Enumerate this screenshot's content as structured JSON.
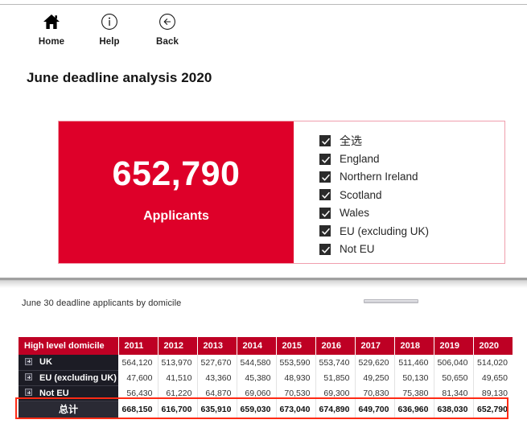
{
  "nav": {
    "items": [
      {
        "label": "Home",
        "icon": "home-icon"
      },
      {
        "label": "Help",
        "icon": "info-circle-icon"
      },
      {
        "label": "Back",
        "icon": "back-arrow-circle-icon"
      }
    ]
  },
  "page": {
    "title": "June deadline analysis 2020"
  },
  "hero": {
    "number": "652,790",
    "caption": "Applicants",
    "color": "#DE0029"
  },
  "filters": {
    "items": [
      {
        "label": "全选",
        "checked": true,
        "cjk": true
      },
      {
        "label": "England",
        "checked": true,
        "cjk": false
      },
      {
        "label": "Northern Ireland",
        "checked": true,
        "cjk": false
      },
      {
        "label": "Scotland",
        "checked": true,
        "cjk": false
      },
      {
        "label": "Wales",
        "checked": true,
        "cjk": false
      },
      {
        "label": "EU (excluding UK)",
        "checked": true,
        "cjk": false
      },
      {
        "label": "Not EU",
        "checked": true,
        "cjk": false
      }
    ]
  },
  "chart_section": {
    "caption": "June 30 deadline applicants by domicile"
  },
  "chart_data": {
    "type": "table",
    "title": "June 30 deadline applicants by domicile",
    "xlabel": "",
    "ylabel": "",
    "header_label": "High level domicile",
    "categories": [
      "2011",
      "2012",
      "2013",
      "2014",
      "2015",
      "2016",
      "2017",
      "2018",
      "2019",
      "2020"
    ],
    "series": [
      {
        "name": "UK",
        "values": [
          564120,
          513970,
          527670,
          544580,
          553590,
          553740,
          529620,
          511460,
          506040,
          514020
        ]
      },
      {
        "name": "EU (excluding UK)",
        "values": [
          47600,
          41510,
          43360,
          45380,
          48930,
          51850,
          49250,
          50130,
          50650,
          49650
        ]
      },
      {
        "name": "Not EU",
        "values": [
          56430,
          61220,
          64870,
          69060,
          70530,
          69300,
          70830,
          75380,
          81340,
          89130
        ]
      },
      {
        "name": "总计",
        "values": [
          668150,
          616700,
          635910,
          659030,
          673040,
          674890,
          649700,
          636960,
          638030,
          652790
        ]
      }
    ],
    "rows": [
      {
        "label": "UK",
        "expandable": true,
        "total": false,
        "values": [
          "564,120",
          "513,970",
          "527,670",
          "544,580",
          "553,590",
          "553,740",
          "529,620",
          "511,460",
          "506,040",
          "514,020"
        ]
      },
      {
        "label": "EU (excluding UK)",
        "expandable": true,
        "total": false,
        "values": [
          "47,600",
          "41,510",
          "43,360",
          "45,380",
          "48,930",
          "51,850",
          "49,250",
          "50,130",
          "50,650",
          "49,650"
        ]
      },
      {
        "label": "Not EU",
        "expandable": true,
        "total": false,
        "values": [
          "56,430",
          "61,220",
          "64,870",
          "69,060",
          "70,530",
          "69,300",
          "70,830",
          "75,380",
          "81,340",
          "89,130"
        ]
      },
      {
        "label": "总计",
        "expandable": false,
        "total": true,
        "values": [
          "668,150",
          "616,700",
          "635,910",
          "659,030",
          "673,040",
          "674,890",
          "649,700",
          "636,960",
          "638,030",
          "652,790"
        ]
      }
    ],
    "highlight_row_color": "#FF2B15",
    "header_color": "#BE0024",
    "rowhead_color": "#1C1C25"
  }
}
